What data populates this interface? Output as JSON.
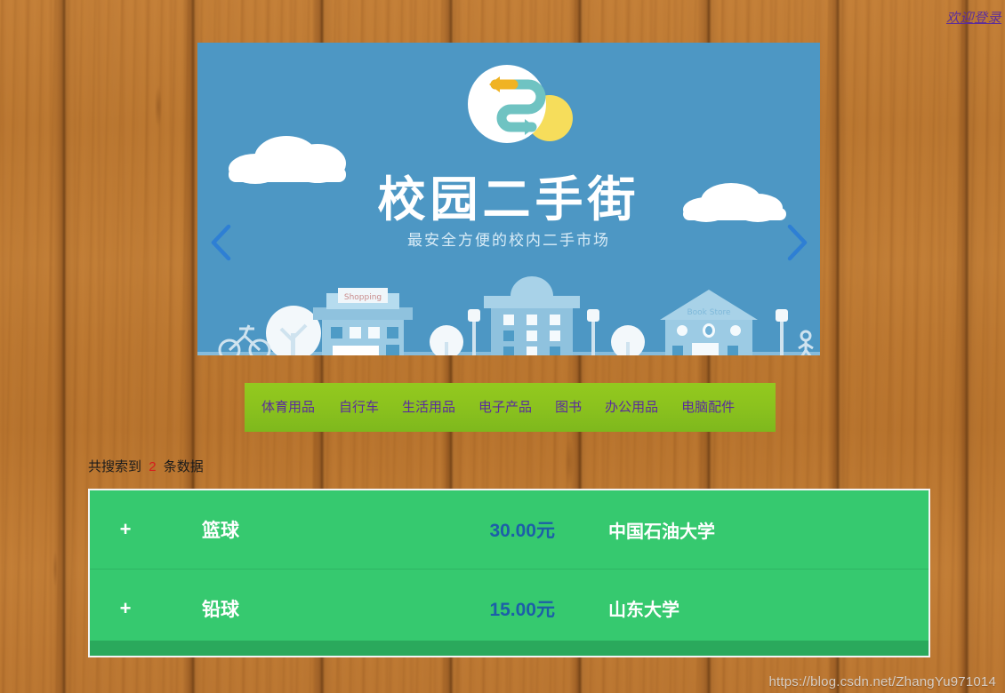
{
  "page": {
    "background_color": "#bd7b33",
    "watermark": "https://blog.csdn.net/ZhangYu971014"
  },
  "topbar": {
    "welcome_link": "欢迎登录",
    "welcome_link_color": "#5b2d9b"
  },
  "banner": {
    "title": "校园二手街",
    "subtitle": "最安全方便的校内二手市场",
    "logo_text": "2",
    "background_color": "#4d97c4",
    "prev_icon": "chevron-left-icon",
    "next_icon": "chevron-right-icon",
    "arrow_color": "#2e7fd4",
    "shop_sign": "Shopping",
    "bookstore_sign": "Book Store"
  },
  "category_nav": {
    "background_color": "#8cc31e",
    "text_color": "#5b2d9b",
    "items": [
      {
        "label": "体育用品"
      },
      {
        "label": "自行车"
      },
      {
        "label": "生活用品"
      },
      {
        "label": "电子产品"
      },
      {
        "label": "图书"
      },
      {
        "label": "办公用品"
      },
      {
        "label": "电脑配件"
      }
    ]
  },
  "results": {
    "count_prefix": "共搜索到",
    "count": "2",
    "count_suffix": "条数据",
    "count_color": "#d71d1d",
    "panel_color": "#36c96f",
    "footer_color": "#2aa95c",
    "price_color": "#1c5fa8",
    "add_symbol": "+",
    "rows": [
      {
        "add": "+",
        "name": "篮球",
        "price": "30.00元",
        "school": "中国石油大学"
      },
      {
        "add": "+",
        "name": "铅球",
        "price": "15.00元",
        "school": "山东大学"
      }
    ]
  }
}
